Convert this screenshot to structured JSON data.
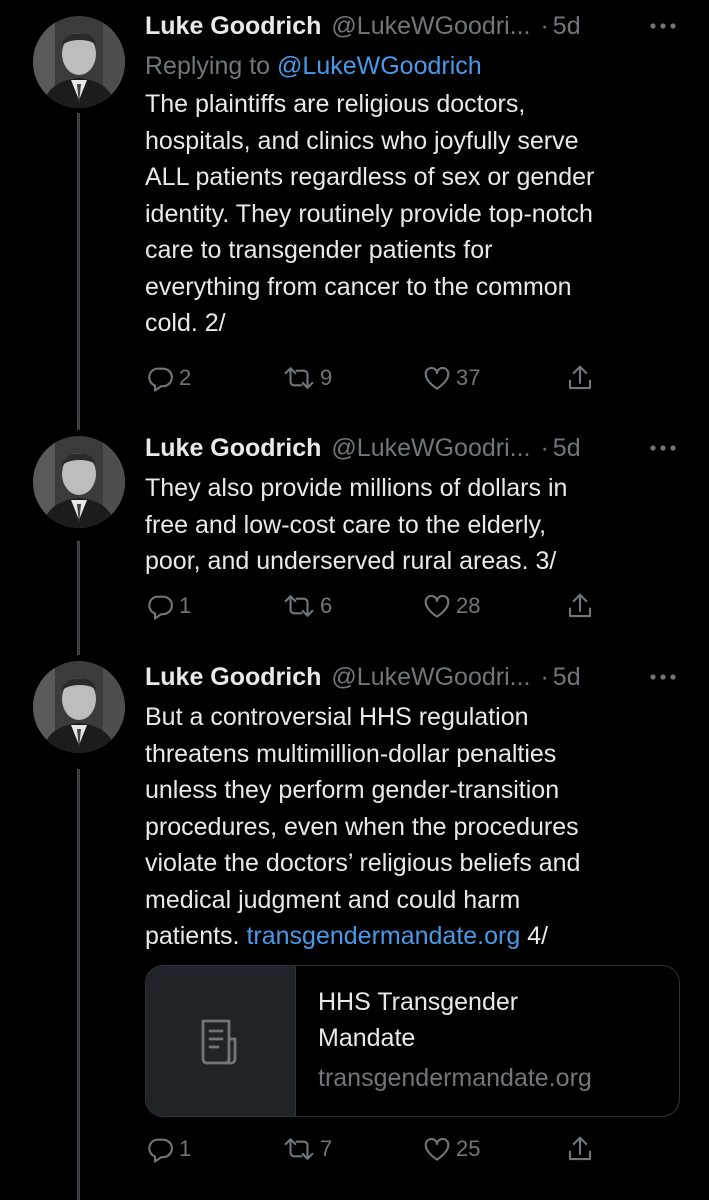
{
  "colors": {
    "background": "#000000",
    "text": "#e7e9ea",
    "secondary": "#71767b",
    "link": "#4a99e9",
    "thread_line": "#3e4144"
  },
  "tweets": [
    {
      "author_name": "Luke Goodrich",
      "author_handle": "@LukeWGoodri...",
      "separator": "·",
      "time": "5d",
      "replying_label": "Replying to",
      "replying_to": "@LukeWGoodrich",
      "lines": [
        "The plaintiffs are religious doctors,",
        "hospitals, and clinics who joyfully serve",
        "ALL patients regardless of sex or gender",
        "identity. They routinely provide top-notch",
        "care to transgender patients for",
        "everything from cancer to the common",
        "cold. 2/"
      ],
      "replies": "2",
      "retweets": "9",
      "likes": "37"
    },
    {
      "author_name": "Luke Goodrich",
      "author_handle": "@LukeWGoodri...",
      "separator": "·",
      "time": "5d",
      "lines": [
        "They also provide millions of dollars in",
        "free and low-cost care to the elderly,",
        "poor, and underserved rural areas. 3/"
      ],
      "replies": "1",
      "retweets": "6",
      "likes": "28"
    },
    {
      "author_name": "Luke Goodrich",
      "author_handle": "@LukeWGoodri...",
      "separator": "·",
      "time": "5d",
      "lines": [
        "But a controversial HHS regulation",
        "threatens multimillion-dollar penalties",
        "unless they perform gender-transition",
        "procedures, even when the procedures",
        "violate the doctors’ religious beliefs and",
        "medical judgment and could harm"
      ],
      "last_line_prefix": "patients.",
      "link_text": "transgendermandate.org",
      "last_line_suffix": "4/",
      "card": {
        "title_line1": "HHS Transgender",
        "title_line2": "Mandate",
        "domain": "transgendermandate.org",
        "thumb_icon": "document-icon"
      },
      "replies": "1",
      "retweets": "7",
      "likes": "25"
    }
  ],
  "icons": {
    "reply": "reply-icon",
    "retweet": "retweet-icon",
    "like": "heart-icon",
    "share": "share-icon",
    "more": "more-options-icon"
  }
}
